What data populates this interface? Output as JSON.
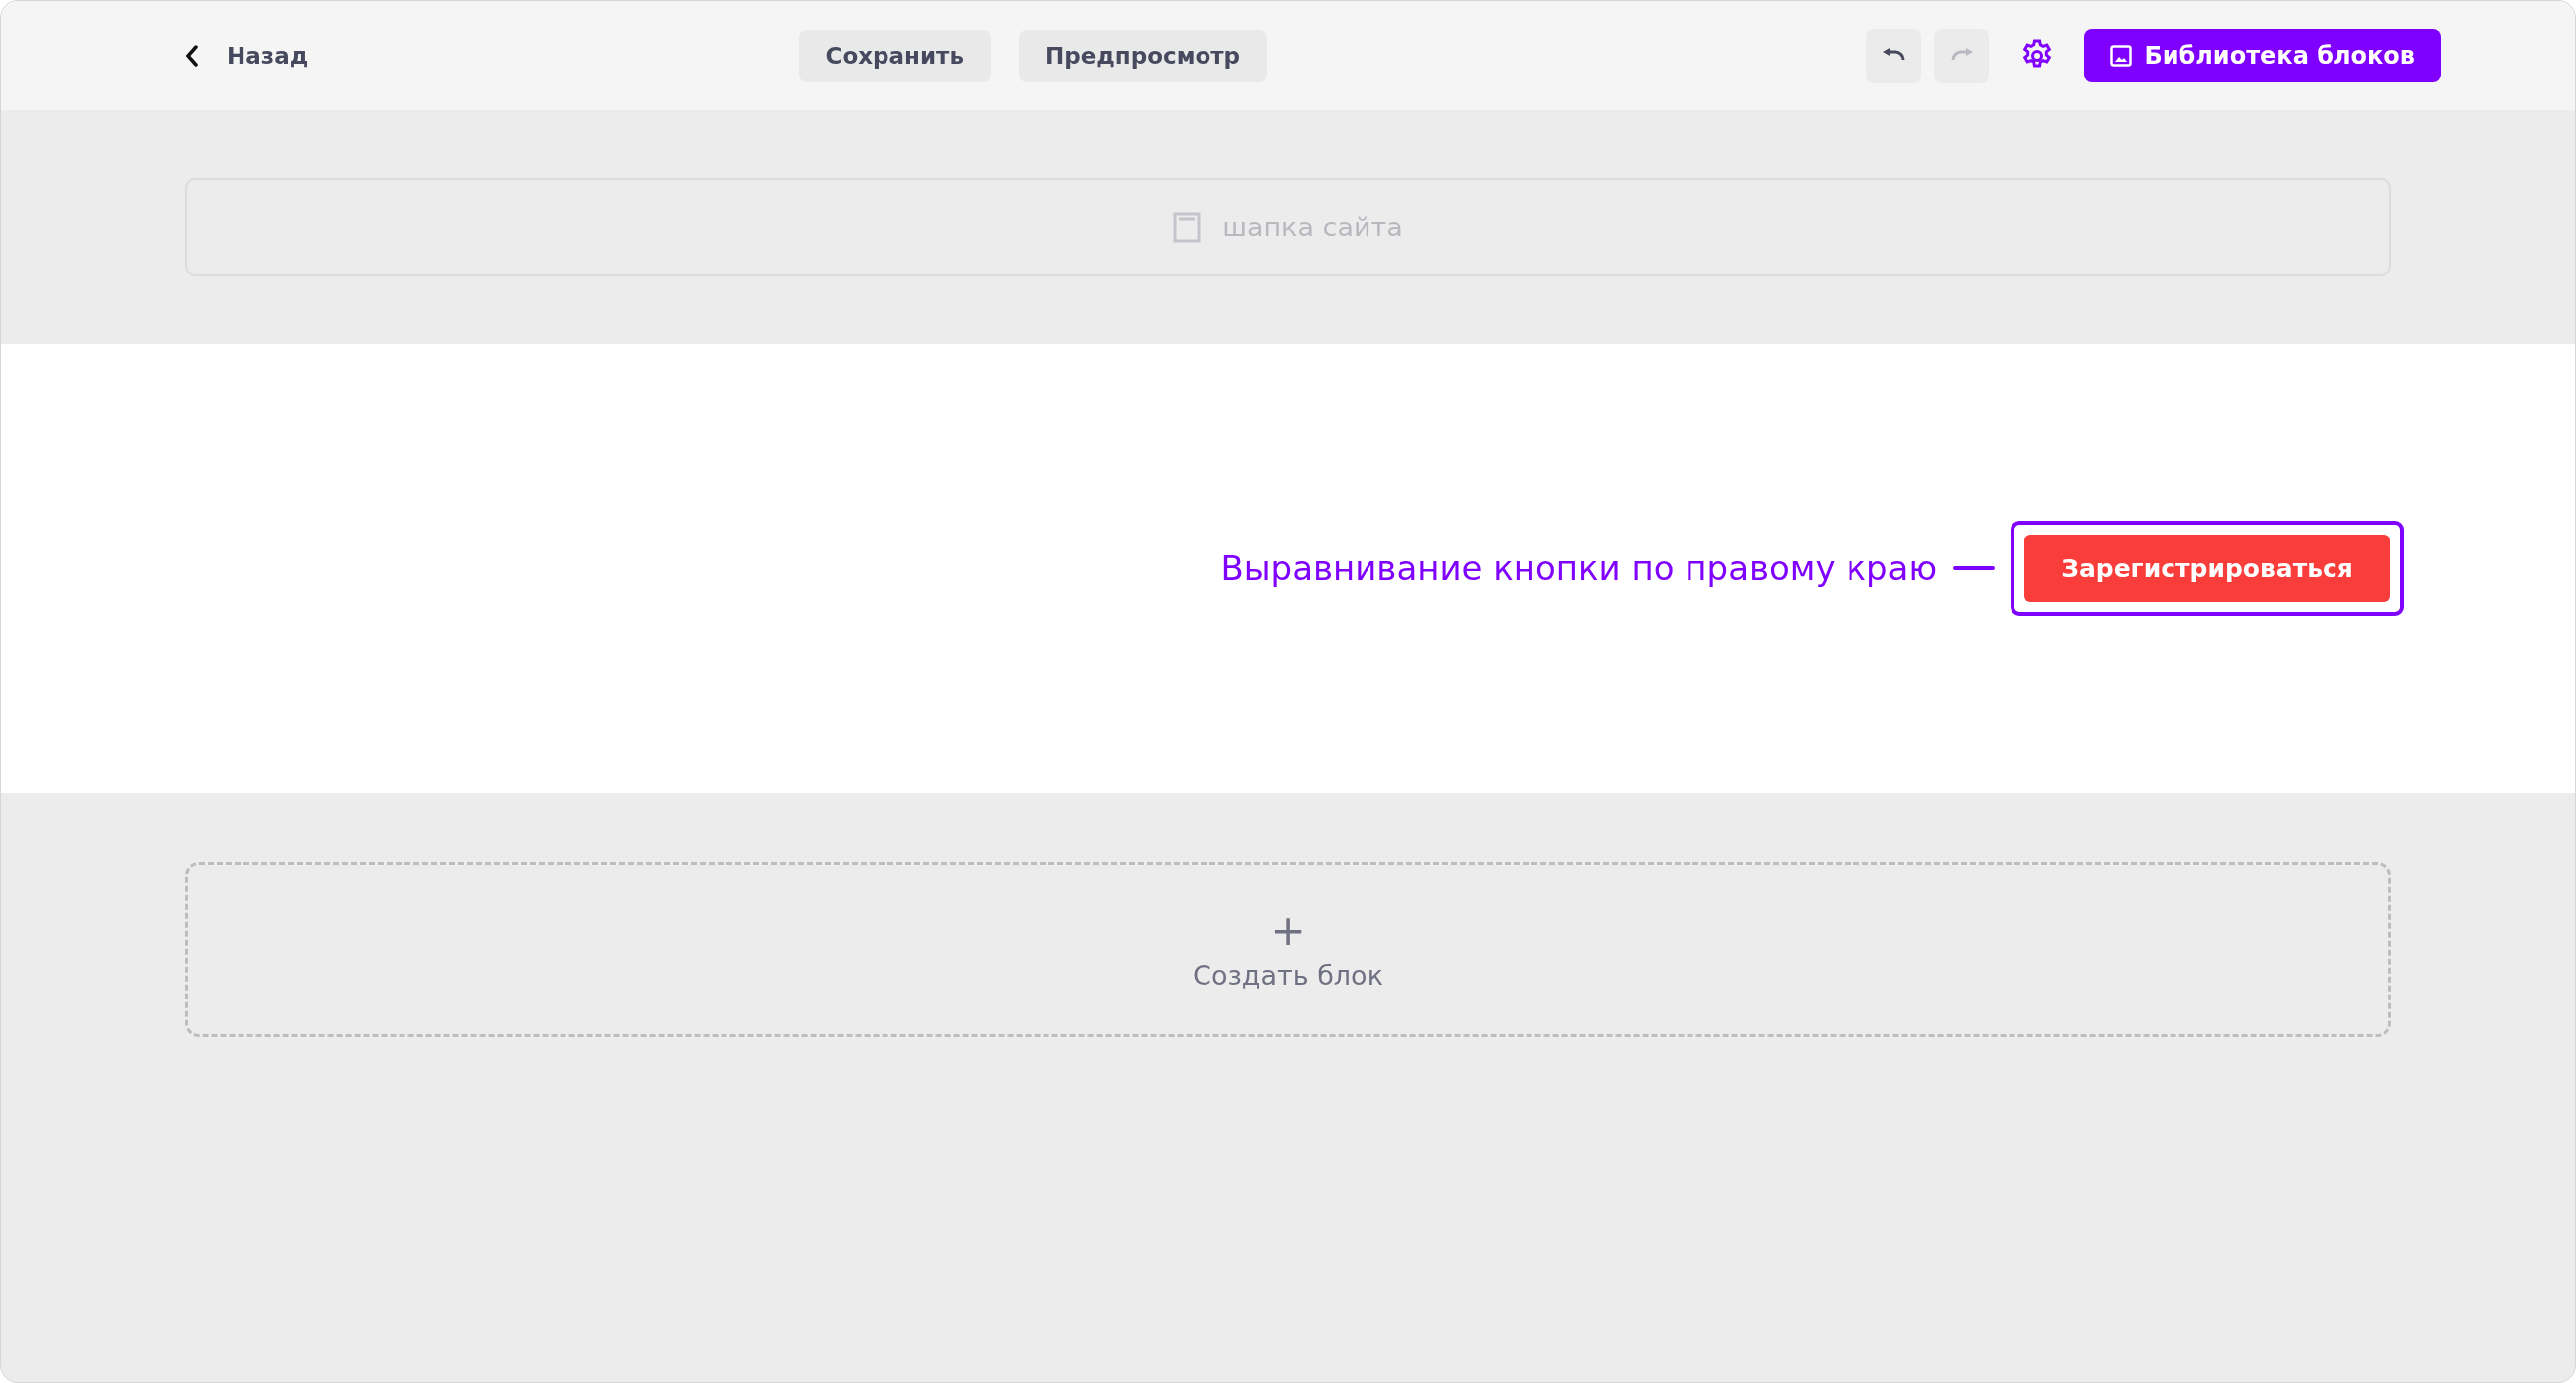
{
  "toolbar": {
    "back": {
      "label": "Назад"
    },
    "buttons": [
      {
        "label": "Сохранить"
      },
      {
        "label": "Предпросмотр"
      }
    ],
    "history": [
      {
        "kind": "undo",
        "disabled": false
      },
      {
        "kind": "redo",
        "disabled": true
      }
    ],
    "library_button": {
      "label": "Библиотека блоков"
    }
  },
  "header_block": {
    "label": "шапка сайта"
  },
  "content": {
    "annotation": "Выравнивание кнопки по правому краю",
    "highlighted": true,
    "cta": {
      "label": "Зарегистрироваться"
    }
  },
  "create_block": {
    "icon": "+",
    "label": "Создать блок"
  }
}
